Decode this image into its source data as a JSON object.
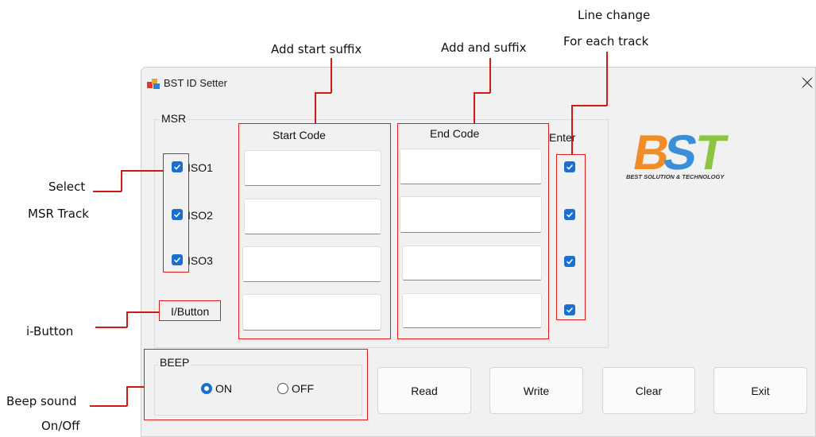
{
  "annotations": {
    "line_change": "Line change",
    "for_each_track": "For each track",
    "add_start_suffix": "Add start suffix",
    "add_end_suffix": "Add and suffix",
    "select": "Select",
    "msr_track": "MSR Track",
    "i_button": "i-Button",
    "beep_sound": "Beep sound",
    "on_off": "On/Off"
  },
  "window": {
    "title": "BST ID Setter",
    "app_icon": "app-icon",
    "close_icon": "close-icon"
  },
  "msr": {
    "group_label": "MSR",
    "start_code_header": "Start Code",
    "end_code_header": "End Code",
    "enter_header": "Enter",
    "tracks": [
      {
        "label": "ISO1",
        "checked": true,
        "start_code": "",
        "end_code": "",
        "enter": true
      },
      {
        "label": "ISO2",
        "checked": true,
        "start_code": "",
        "end_code": "",
        "enter": true
      },
      {
        "label": "ISO3",
        "checked": true,
        "start_code": "",
        "end_code": "",
        "enter": true
      }
    ],
    "ibutton": {
      "label": "I/Button",
      "start_code": "",
      "end_code": "",
      "enter": true
    }
  },
  "logo": {
    "text": "BST",
    "tagline": "BEST SOLUTION & TECHNOLOGY",
    "colors": {
      "b": "#f28c28",
      "s": "#3a8fd8",
      "t": "#8cc63f"
    }
  },
  "beep": {
    "group_label": "BEEP",
    "on_label": "ON",
    "off_label": "OFF",
    "selected": "ON"
  },
  "buttons": {
    "read": "Read",
    "write": "Write",
    "clear": "Clear",
    "exit": "Exit"
  },
  "colors": {
    "annotation": "#e21b1b",
    "checkbox": "#1a6fd1"
  }
}
